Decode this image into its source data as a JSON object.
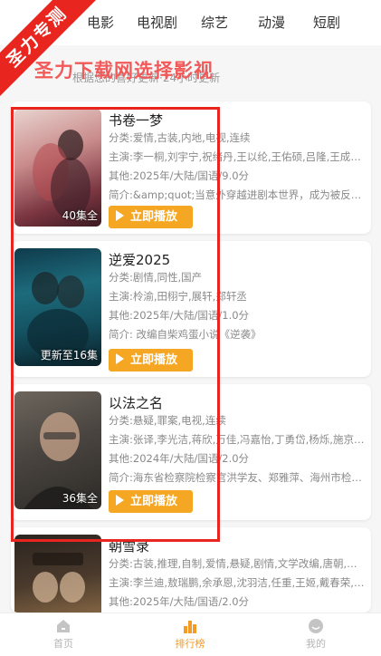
{
  "top_tabs": [
    "电影",
    "电视剧",
    "综艺",
    "动漫",
    "短剧"
  ],
  "ribbon_text": "圣力专测",
  "promo_text": "圣力下载网选择影视",
  "update_note": "根据您的喜好更新·24小时更新",
  "play_label": "立即播放",
  "items": [
    {
      "title": "书卷一梦",
      "genre": "分类:爱情,古装,内地,电视,连续",
      "cast": "主演:李一桐,刘宇宁,祝绪丹,王以纶,王佑硕,吕隆,王成思,...",
      "other": "其他:2025年/大陆/国语/9.0分",
      "intro": "简介:&amp;quot;当意外穿越进剧本世界，成为被反派男...",
      "episodes": "40集全"
    },
    {
      "title": "逆爱2025",
      "genre": "分类:剧情,同性,国产",
      "cast": "主演:柃渝,田栩宁,展轩,郑轩丞",
      "other": "其他:2025年/大陆/国语/1.0分",
      "intro": "简介:        改编自柴鸡蛋小说《逆袭》",
      "episodes": "更新至16集"
    },
    {
      "title": "以法之名",
      "genre": "分类:悬疑,罪案,电视,连续",
      "cast": "主演:张译,李光洁,蒋欣,万佳,冯嘉怡,丁勇岱,杨烁,施京明,...",
      "other": "其他:2024年/大陆/国语/2.0分",
      "intro": "简介:海东省检察院检察官洪学友、郑雅萍、海州市检察...",
      "episodes": "36集全"
    },
    {
      "title": "朝雪录",
      "genre": "分类:古装,推理,自制,爱情,悬疑,剧情,文学改编,唐朝,内地,...",
      "cast": "主演:李兰迪,敖瑞鹏,余承恩,沈羽洁,任重,王姬,戴春荣,邓英",
      "other": "其他:2025年/大陆/国语/2.0分",
      "intro": "",
      "episodes": ""
    }
  ],
  "bottom_nav": [
    {
      "label": "首页",
      "icon": "home-icon"
    },
    {
      "label": "排行榜",
      "icon": "bar-chart-icon"
    },
    {
      "label": "我的",
      "icon": "profile-icon"
    }
  ],
  "colors": {
    "accent": "#f5a623",
    "ribbon": "#e8251f",
    "promo": "#f25a5a",
    "highlight": "#e8251f"
  }
}
